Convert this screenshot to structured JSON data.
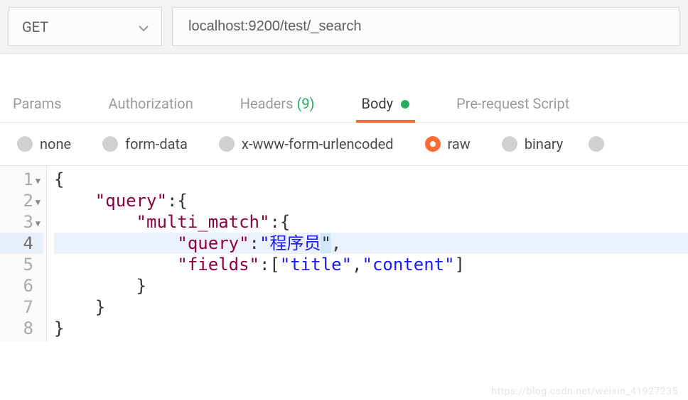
{
  "request": {
    "method": "GET",
    "url": "localhost:9200/test/_search"
  },
  "tabs": {
    "params": "Params",
    "authorization": "Authorization",
    "headers_label": "Headers",
    "headers_count": "(9)",
    "body": "Body",
    "prerequest": "Pre-request Script"
  },
  "body_type": {
    "none": "none",
    "formdata": "form-data",
    "xwww": "x-www-form-urlencoded",
    "raw": "raw",
    "binary": "binary",
    "selected": "raw"
  },
  "editor": {
    "highlighted_line_index": 3,
    "tokens": [
      [
        [
          "p",
          "{"
        ]
      ],
      [
        [
          "p",
          "    "
        ],
        [
          "k",
          "\"query\""
        ],
        [
          "p",
          ":{"
        ]
      ],
      [
        [
          "p",
          "        "
        ],
        [
          "k",
          "\"multi_match\""
        ],
        [
          "p",
          ":{"
        ]
      ],
      [
        [
          "p",
          "            "
        ],
        [
          "k",
          "\"query\""
        ],
        [
          "p",
          ":"
        ],
        [
          "s",
          "\"程序员"
        ],
        [
          "cur",
          "\""
        ],
        [
          "p",
          ","
        ]
      ],
      [
        [
          "p",
          "            "
        ],
        [
          "k",
          "\"fields\""
        ],
        [
          "p",
          ":["
        ],
        [
          "s",
          "\"title\""
        ],
        [
          "p",
          ","
        ],
        [
          "s",
          "\"content\""
        ],
        [
          "p",
          "]"
        ]
      ],
      [
        [
          "p",
          "        }"
        ]
      ],
      [
        [
          "p",
          "    }"
        ]
      ],
      [
        [
          "p",
          "}"
        ]
      ]
    ],
    "fold_lines": [
      0,
      1,
      2
    ]
  },
  "watermark": "https://blog.csdn.net/weixin_41927235"
}
